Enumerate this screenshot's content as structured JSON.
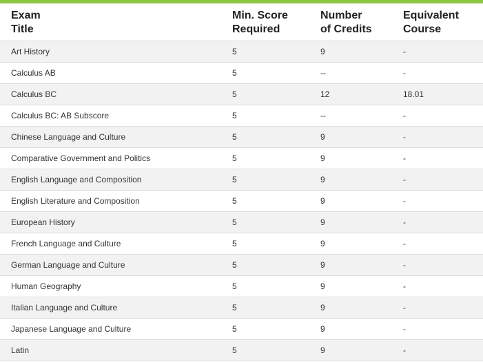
{
  "table": {
    "headers": [
      {
        "line1": "Exam",
        "line2": "Title"
      },
      {
        "line1": "Min. Score",
        "line2": "Required"
      },
      {
        "line1": "Number",
        "line2": "of Credits"
      },
      {
        "line1": "Equivalent",
        "line2": "Course"
      }
    ],
    "rows": [
      [
        "Art History",
        "5",
        "9",
        "-"
      ],
      [
        "Calculus AB",
        "5",
        "--",
        "-"
      ],
      [
        "Calculus BC",
        "5",
        "12",
        "18.01"
      ],
      [
        "Calculus BC: AB Subscore",
        "5",
        "--",
        "-"
      ],
      [
        "Chinese Language and Culture",
        "5",
        "9",
        "-"
      ],
      [
        "Comparative Government and Politics",
        "5",
        "9",
        "-"
      ],
      [
        "English Language and Composition",
        "5",
        "9",
        "-"
      ],
      [
        "English Literature and Composition",
        "5",
        "9",
        "-"
      ],
      [
        "European History",
        "5",
        "9",
        "-"
      ],
      [
        "French Language and Culture",
        "5",
        "9",
        "-"
      ],
      [
        "German Language and Culture",
        "5",
        "9",
        "-"
      ],
      [
        "Human Geography",
        "5",
        "9",
        "-"
      ],
      [
        "Italian Language and Culture",
        "5",
        "9",
        "-"
      ],
      [
        "Japanese Language and Culture",
        "5",
        "9",
        "-"
      ],
      [
        "Latin",
        "5",
        "9",
        "-"
      ]
    ]
  },
  "colors": {
    "accent": "#8dc63f",
    "row_alt": "#f2f2f2",
    "row": "#ffffff"
  }
}
